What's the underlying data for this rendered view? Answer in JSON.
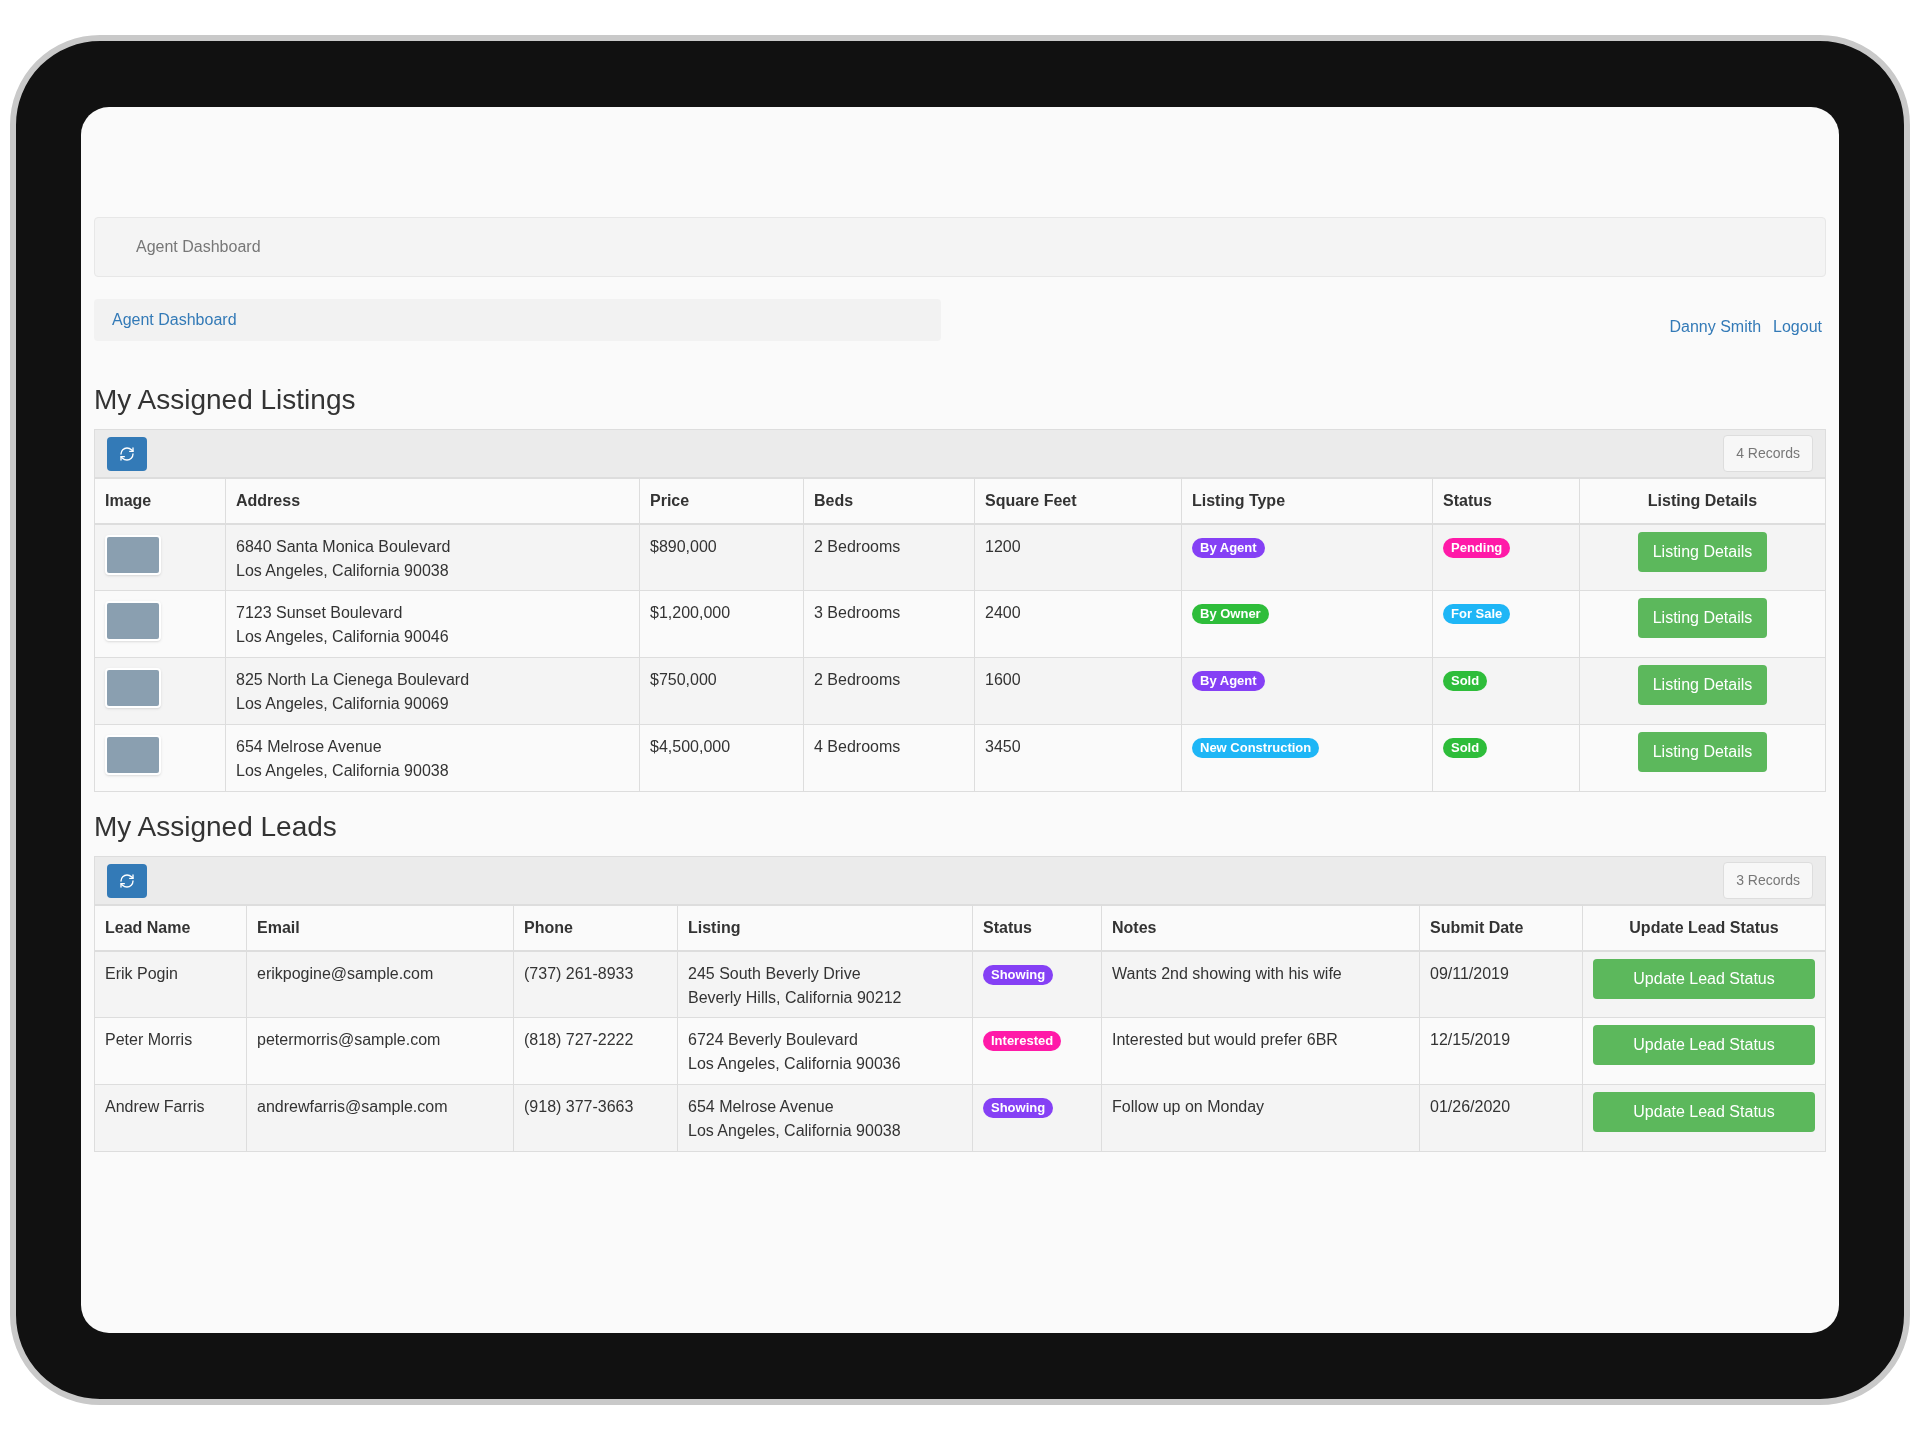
{
  "header": {
    "title": "Agent Dashboard"
  },
  "breadcrumb": {
    "items": [
      {
        "label": "Agent Dashboard"
      }
    ]
  },
  "user": {
    "name": "Danny Smith",
    "logout": "Logout"
  },
  "listings": {
    "title": "My Assigned Listings",
    "records": "4 Records",
    "columns": [
      "Image",
      "Address",
      "Price",
      "Beds",
      "Square Feet",
      "Listing Type",
      "Status",
      "Listing Details"
    ],
    "rows": [
      {
        "address": [
          "6840 Santa Monica Boulevard",
          "Los Angeles, California 90038"
        ],
        "price": "$890,000",
        "beds": "2 Bedrooms",
        "sqft": "1200",
        "listing_type": {
          "label": "By Agent",
          "color": "#8540f5"
        },
        "status": {
          "label": "Pending",
          "color": "#ff1aa8"
        },
        "action": "Listing Details"
      },
      {
        "address": [
          "7123 Sunset Boulevard",
          "Los Angeles, California 90046"
        ],
        "price": "$1,200,000",
        "beds": "3 Bedrooms",
        "sqft": "2400",
        "listing_type": {
          "label": "By Owner",
          "color": "#2ebd3a"
        },
        "status": {
          "label": "For Sale",
          "color": "#1eb6f6"
        },
        "action": "Listing Details"
      },
      {
        "address": [
          "825 North La Cienega Boulevard",
          "Los Angeles, California 90069"
        ],
        "price": "$750,000",
        "beds": "2 Bedrooms",
        "sqft": "1600",
        "listing_type": {
          "label": "By Agent",
          "color": "#8540f5"
        },
        "status": {
          "label": "Sold",
          "color": "#2ebd3a"
        },
        "action": "Listing Details"
      },
      {
        "address": [
          "654 Melrose Avenue",
          "Los Angeles, California 90038"
        ],
        "price": "$4,500,000",
        "beds": "4 Bedrooms",
        "sqft": "3450",
        "listing_type": {
          "label": "New Construction",
          "color": "#1eb6f6"
        },
        "status": {
          "label": "Sold",
          "color": "#2ebd3a"
        },
        "action": "Listing Details"
      }
    ]
  },
  "leads": {
    "title": "My Assigned Leads",
    "records": "3 Records",
    "columns": [
      "Lead Name",
      "Email",
      "Phone",
      "Listing",
      "Status",
      "Notes",
      "Submit Date",
      "Update Lead Status"
    ],
    "rows": [
      {
        "name": "Erik Pogin",
        "email": "erikpogine@sample.com",
        "phone": "(737) 261-8933",
        "listing": [
          "245 South Beverly Drive",
          "Beverly Hills, California 90212"
        ],
        "status": {
          "label": "Showing",
          "color": "#8540f5"
        },
        "notes": "Wants 2nd showing with his wife",
        "date": "09/11/2019",
        "action": "Update Lead Status"
      },
      {
        "name": "Peter Morris",
        "email": "petermorris@sample.com",
        "phone": "(818) 727-2222",
        "listing": [
          "6724 Beverly Boulevard",
          "Los Angeles, California 90036"
        ],
        "status": {
          "label": "Interested",
          "color": "#ff1aa8"
        },
        "notes": "Interested but would prefer 6BR",
        "date": "12/15/2019",
        "action": "Update Lead Status"
      },
      {
        "name": "Andrew Farris",
        "email": "andrewfarris@sample.com",
        "phone": "(918) 377-3663",
        "listing": [
          "654 Melrose Avenue",
          "Los Angeles, California 90038"
        ],
        "status": {
          "label": "Showing",
          "color": "#8540f5"
        },
        "notes": "Follow up on Monday",
        "date": "01/26/2020",
        "action": "Update Lead Status"
      }
    ]
  }
}
